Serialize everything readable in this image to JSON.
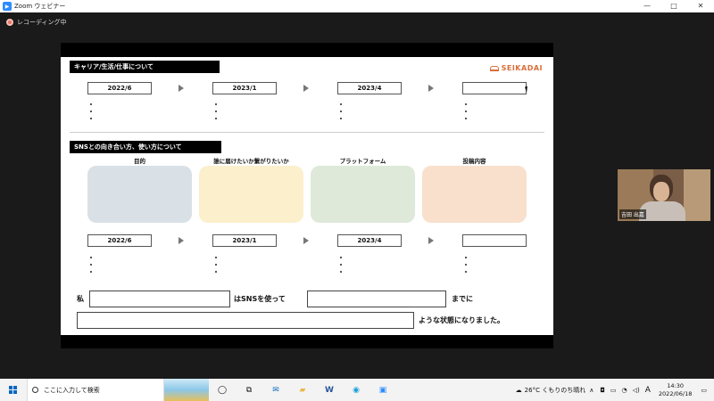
{
  "window": {
    "title": "Zoom ウェビナー",
    "controls": [
      "—",
      "□",
      "✕"
    ]
  },
  "recording": {
    "label": "レコーディング中"
  },
  "slide": {
    "logo": "SEIKADAI",
    "section1": {
      "title": "キャリア/生活/仕事について",
      "dates": [
        "2022/6",
        "2023/1",
        "2023/4",
        ""
      ]
    },
    "section2": {
      "title": "SNSとの向き合い方、使い方について",
      "columns": [
        {
          "label": "目的",
          "color": "#d9e0e6"
        },
        {
          "label": "誰に届けたいか繋がりたいか",
          "color": "#fbefcc"
        },
        {
          "label": "プラットフォーム",
          "color": "#dfe9da"
        },
        {
          "label": "投稿内容",
          "color": "#f8e0cc"
        }
      ],
      "dates": [
        "2022/6",
        "2023/1",
        "2023/4",
        ""
      ]
    },
    "sentence": {
      "part1": "私",
      "part2": "はSNSを使って",
      "part3": "までに",
      "part4": "ような状態になりました。"
    }
  },
  "participant": {
    "name": "吉田 出嘉"
  },
  "taskbar": {
    "search_placeholder": "ここに入力して検索",
    "weather": "26°C くもりのち晴れ",
    "ime": "A",
    "time": "14:30",
    "date": "2022/06/18"
  }
}
